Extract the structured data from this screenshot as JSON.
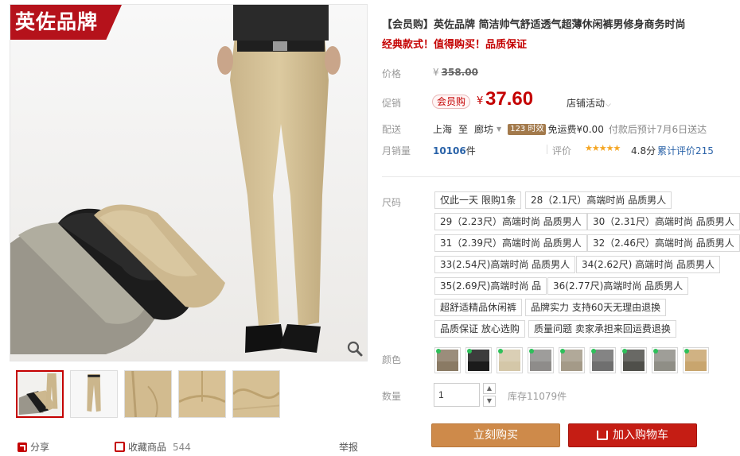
{
  "gallery": {
    "brand_badge": "英佐品牌",
    "thumbnails": [
      "thumb-folded-pants",
      "thumb-full-pants",
      "thumb-detail-waist",
      "thumb-detail-fabric",
      "thumb-detail-seam"
    ]
  },
  "actions": {
    "share": "分享",
    "favorite": "收藏商品",
    "favorite_count": "544",
    "report": "举报"
  },
  "product": {
    "title": "【会员购】英佐品牌 简洁帅气舒适透气超薄休闲裤男修身商务时尚",
    "subtitle": "经典款式！值得购买！品质保证"
  },
  "price": {
    "label": "价格",
    "currency": "¥",
    "original": "358.00"
  },
  "promo": {
    "label": "促销",
    "tag": "会员购",
    "currency": "¥",
    "price": "37.60",
    "store_activity": "店铺活动"
  },
  "delivery": {
    "label": "配送",
    "from": "上海",
    "to_word": "至",
    "to": "廊坊",
    "badge": "123 时效",
    "free_shipping": "免运费¥0.00",
    "estimate": "付款后预计7月6日送达"
  },
  "sales": {
    "label": "月销量",
    "count": "10106",
    "unit": "件",
    "rating_label": "评价",
    "stars": "★★★★★",
    "score": "4.8分",
    "review_count": "累计评价215"
  },
  "size": {
    "label": "尺码",
    "options": [
      "仅此一天 限购1条",
      "28（2.1尺）高端时尚 品质男人",
      "29（2.23尺）高端时尚 品质男人",
      "30（2.31尺）高端时尚 品质男人",
      "31（2.39尺）高端时尚 品质男人",
      "32（2.46尺）高端时尚 品质男人",
      "33(2.54尺)高端时尚 品质男人",
      "34(2.62尺) 高端时尚 品质男人",
      "35(2.69尺)高端时尚 品",
      "36(2.77尺)高端时尚 品质男人",
      "超舒适精品休闲裤",
      "品牌实力 支持60天无理由退换",
      "品质保证 放心选购",
      "质量问题 卖家承担来回运费退换"
    ]
  },
  "color": {
    "label": "颜色",
    "swatches": [
      "#8a7a64",
      "#1b1b1b",
      "#d4c7a8",
      "#8e8c8a",
      "#a49a88",
      "#6f6f6f",
      "#4f4f4a",
      "#8f8e86",
      "#c8a56e"
    ]
  },
  "quantity": {
    "label": "数量",
    "value": "1",
    "stock": "库存11079件"
  },
  "buttons": {
    "buy_now": "立刻购买",
    "add_to_cart": "加入购物车"
  },
  "colors": {
    "accent": "#c40000",
    "buy": "#ce8a4a",
    "cart": "#c51d14",
    "link": "#2962a8"
  }
}
